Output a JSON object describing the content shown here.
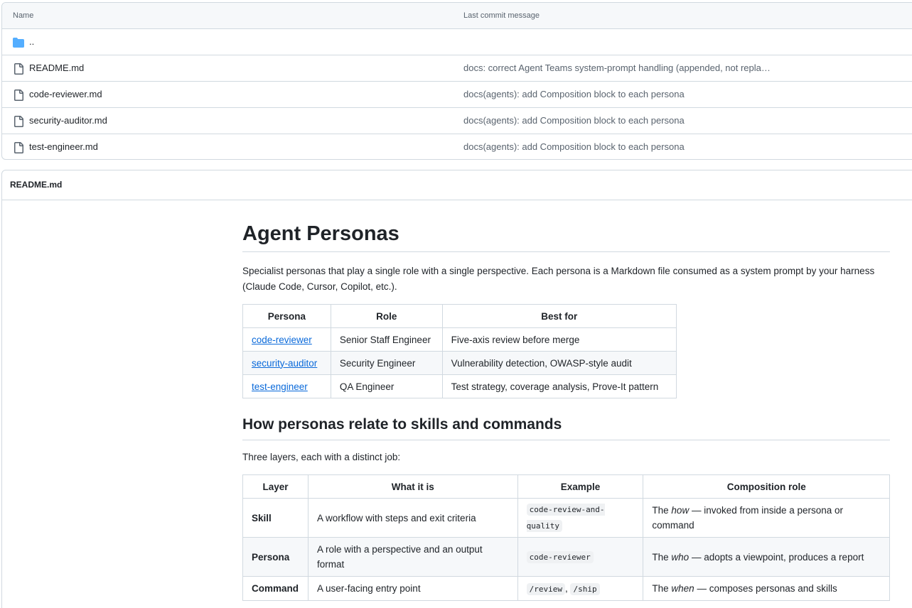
{
  "file_list": {
    "headers": {
      "name": "Name",
      "message": "Last commit message"
    },
    "parent_label": "..",
    "files": [
      {
        "name": "README.md",
        "message": "docs: correct Agent Teams system-prompt handling (appended, not repla…"
      },
      {
        "name": "code-reviewer.md",
        "message": "docs(agents): add Composition block to each persona"
      },
      {
        "name": "security-auditor.md",
        "message": "docs(agents): add Composition block to each persona"
      },
      {
        "name": "test-engineer.md",
        "message": "docs(agents): add Composition block to each persona"
      }
    ]
  },
  "readme": {
    "header_title": "README.md",
    "h1": "Agent Personas",
    "intro": "Specialist personas that play a single role with a single perspective. Each persona is a Markdown file consumed as a system prompt by your harness (Claude Code, Cursor, Copilot, etc.).",
    "personas_table": {
      "headers": [
        "Persona",
        "Role",
        "Best for"
      ],
      "rows": [
        {
          "persona": "code-reviewer",
          "role": "Senior Staff Engineer",
          "best_for": "Five-axis review before merge"
        },
        {
          "persona": "security-auditor",
          "role": "Security Engineer",
          "best_for": "Vulnerability detection, OWASP-style audit"
        },
        {
          "persona": "test-engineer",
          "role": "QA Engineer",
          "best_for": "Test strategy, coverage analysis, Prove-It pattern"
        }
      ]
    },
    "h2": "How personas relate to skills and commands",
    "layers_intro": "Three layers, each with a distinct job:",
    "layers_table": {
      "headers": [
        "Layer",
        "What it is",
        "Example",
        "Composition role"
      ],
      "rows": [
        {
          "layer": "Skill",
          "what": "A workflow with steps and exit criteria",
          "example": [
            "code-review-and-quality"
          ],
          "role_pre": "The ",
          "role_em": "how",
          "role_post": " — invoked from inside a persona or command"
        },
        {
          "layer": "Persona",
          "what": "A role with a perspective and an output format",
          "example": [
            "code-reviewer"
          ],
          "role_pre": "The ",
          "role_em": "who",
          "role_post": " — adopts a viewpoint, produces a report"
        },
        {
          "layer": "Command",
          "what": "A user-facing entry point",
          "example": [
            "/review",
            "/ship"
          ],
          "role_pre": "The ",
          "role_em": "when",
          "role_post": " — composes personas and skills"
        }
      ]
    }
  },
  "colors": {
    "link": "#0969da",
    "folder_icon": "#54aeff",
    "border": "#d1d9e0",
    "muted_text": "#59636e"
  },
  "icons": {
    "folder": "folder-icon",
    "file": "file-icon"
  }
}
